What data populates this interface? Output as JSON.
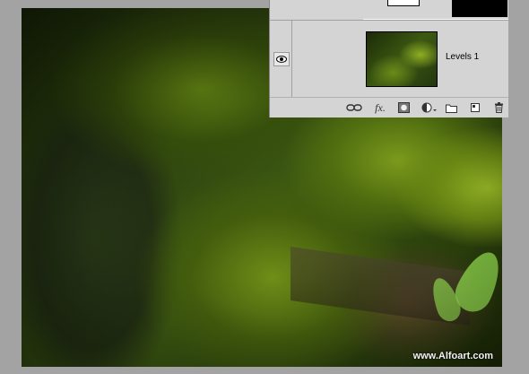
{
  "canvas": {
    "watermark": "www.Alfoart.com"
  },
  "layers_panel": {
    "layers": [
      {
        "name": "Levels 1",
        "visible": true
      }
    ],
    "toolbar": {
      "fx_label": "fx."
    }
  }
}
